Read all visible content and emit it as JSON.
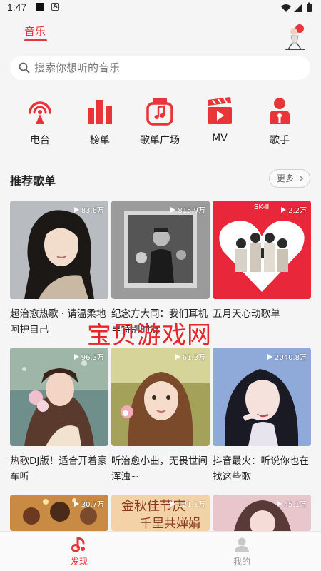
{
  "status": {
    "time": "1:47"
  },
  "header": {
    "tab_label": "音乐"
  },
  "search": {
    "placeholder": "搜索你想听的音乐"
  },
  "categories": [
    {
      "label": "电台",
      "icon": "radio-icon"
    },
    {
      "label": "榜单",
      "icon": "chart-icon"
    },
    {
      "label": "歌单广场",
      "icon": "playlist-square-icon"
    },
    {
      "label": "MV",
      "icon": "mv-icon"
    },
    {
      "label": "歌手",
      "icon": "singer-icon"
    }
  ],
  "section": {
    "title": "推荐歌单",
    "more_label": "更多"
  },
  "playlists": [
    {
      "title": "超治愈热歌 · 请温柔地呵护自己",
      "plays": "83.6万"
    },
    {
      "title": "纪念方大同：我们耳机里特别的友",
      "plays": "815.9万"
    },
    {
      "title": "五月天心动歌单",
      "plays": "2.2万"
    },
    {
      "title": "热歌DJ版！适合开着豪车听",
      "plays": "96.3万"
    },
    {
      "title": "听治愈小曲，无畏世间浑浊~",
      "plays": "61.3万"
    },
    {
      "title": "抖音最火：听说你也在找这些歌",
      "plays": "2040.8万"
    },
    {
      "title": "",
      "plays": "30.7万",
      "cover_text": ""
    },
    {
      "title": "",
      "plays": "121.1万",
      "cover_text_1": "金秋佳节庆",
      "cover_text_2": "千里共婵娟"
    },
    {
      "title": "",
      "plays": "45.1万"
    }
  ],
  "cover_labels": {
    "skii": "SK-II"
  },
  "watermark": "宝贝游戏网",
  "nav": [
    {
      "label": "发现",
      "active": true
    },
    {
      "label": "我的",
      "active": false
    }
  ],
  "colors": {
    "accent": "#e8353a",
    "background": "#f5f5f5"
  }
}
